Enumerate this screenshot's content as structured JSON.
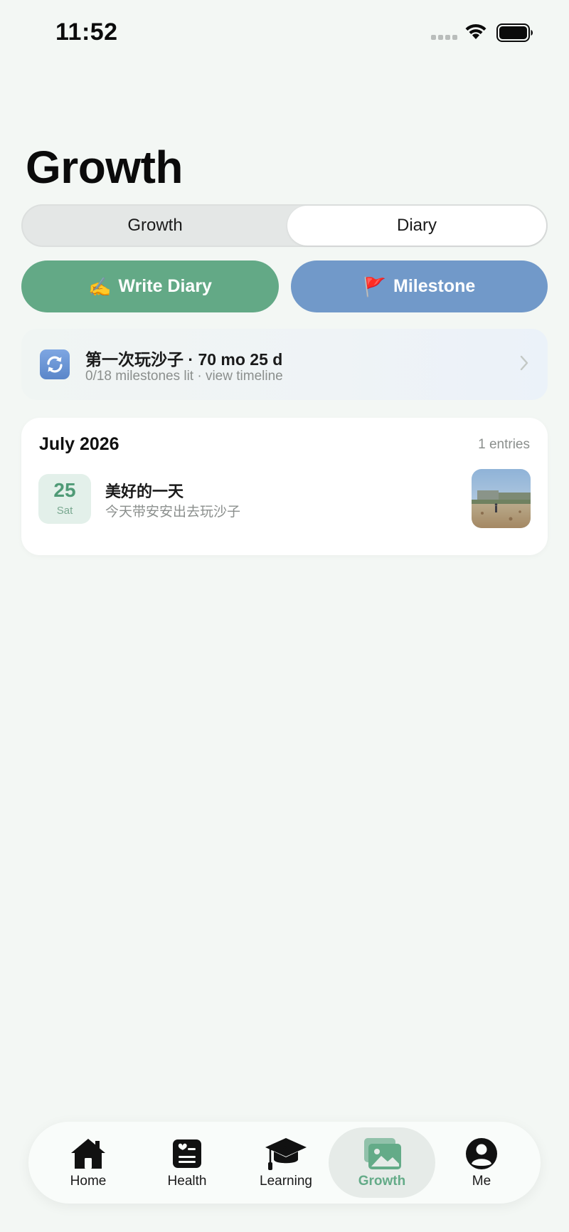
{
  "status_bar": {
    "time": "11:52"
  },
  "page": {
    "title": "Growth"
  },
  "segmented": {
    "tabs": [
      "Growth",
      "Diary"
    ],
    "selected": "Diary"
  },
  "actions": {
    "write_diary": {
      "emoji": "✍️",
      "label": "Write Diary"
    },
    "milestone": {
      "emoji": "🚩",
      "label": "Milestone"
    }
  },
  "milestone_card": {
    "icon": "refresh-icon",
    "title": "第一次玩沙子 · 70 mo 25 d",
    "subtitle": "0/18 milestones lit · view timeline"
  },
  "diary": {
    "month": "July 2026",
    "count": "1 entries",
    "entries": [
      {
        "day": "25",
        "weekday": "Sat",
        "title": "美好的一天",
        "preview": "今天带安安出去玩沙子"
      }
    ]
  },
  "tab_bar": {
    "tabs": [
      {
        "label": "Home",
        "icon": "home-icon"
      },
      {
        "label": "Health",
        "icon": "health-record-icon"
      },
      {
        "label": "Learning",
        "icon": "graduation-cap-icon"
      },
      {
        "label": "Growth",
        "icon": "photos-icon"
      },
      {
        "label": "Me",
        "icon": "person-icon"
      }
    ],
    "active": "Growth"
  },
  "colors": {
    "background": "#f3f7f4",
    "accent_green": "#63a986",
    "accent_blue": "#7199c9",
    "muted_text": "#8b8f8d"
  }
}
